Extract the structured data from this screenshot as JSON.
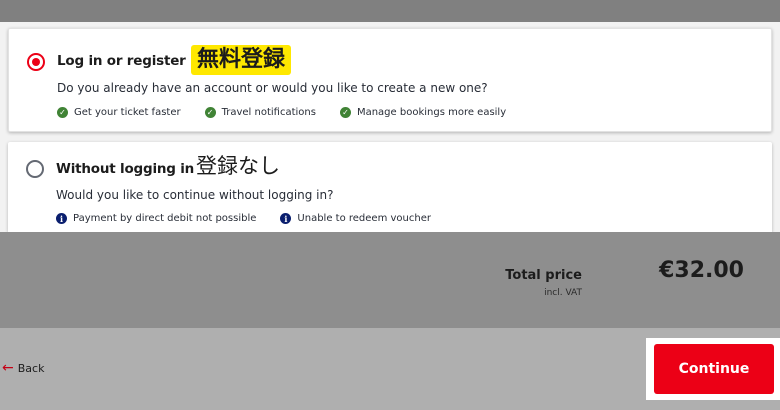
{
  "login_option": {
    "title": "Log in or register",
    "annotation_jp": "無料登録",
    "question": "Do you already have an account or would you like to create a new one?",
    "selected": true,
    "benefits": [
      {
        "icon": "check-circle-icon",
        "label": "Get your ticket faster"
      },
      {
        "icon": "check-circle-icon",
        "label": "Travel notifications"
      },
      {
        "icon": "check-circle-icon",
        "label": "Manage bookings more easily"
      }
    ]
  },
  "guest_option": {
    "title": "Without logging in",
    "annotation_jp": "登録なし",
    "question": "Would you like to continue without logging in?",
    "selected": false,
    "notes": [
      {
        "icon": "info-circle-icon",
        "label": "Payment by direct debit not possible"
      },
      {
        "icon": "info-circle-icon",
        "label": "Unable to redeem voucher"
      }
    ]
  },
  "summary": {
    "total_label": "Total price",
    "vat_label": "incl. VAT",
    "price": "€32.00"
  },
  "footer": {
    "back_label": "Back",
    "continue_label": "Continue"
  },
  "colors": {
    "accent_red": "#ec0016",
    "check_green": "#408335",
    "info_navy": "#0a1e6e",
    "highlight_yellow": "#ffe800"
  }
}
